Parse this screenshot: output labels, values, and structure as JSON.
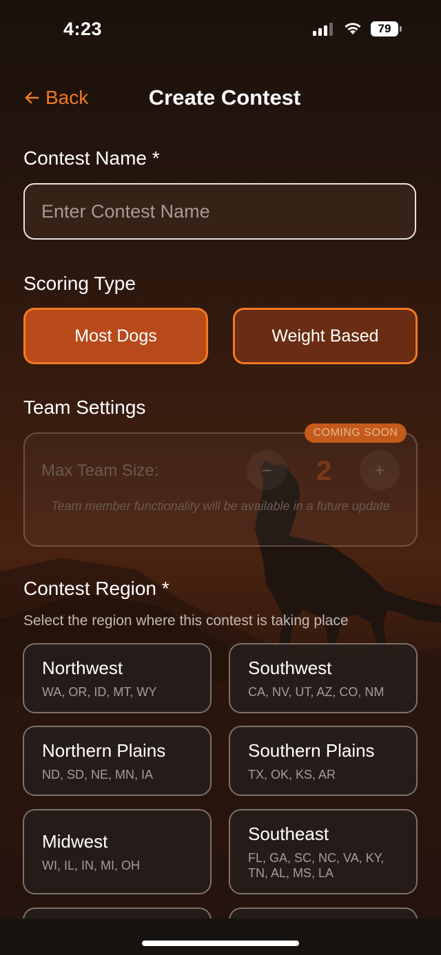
{
  "status_bar": {
    "time": "4:23",
    "battery": "79"
  },
  "header": {
    "back_label": "Back",
    "title": "Create Contest"
  },
  "contest_name": {
    "label": "Contest Name *",
    "placeholder": "Enter Contest Name",
    "value": ""
  },
  "scoring": {
    "label": "Scoring Type",
    "options": [
      "Most Dogs",
      "Weight Based"
    ],
    "selected": "Most Dogs"
  },
  "team": {
    "label": "Team Settings",
    "badge": "COMING SOON",
    "max_label": "Max Team Size:",
    "minus": "−",
    "value": "2",
    "plus": "+",
    "note": "Team member functionality will be available in a future update"
  },
  "region": {
    "label": "Contest Region *",
    "subtitle": "Select the region where this contest is taking place",
    "items": [
      {
        "name": "Northwest",
        "states": "WA, OR, ID, MT, WY"
      },
      {
        "name": "Southwest",
        "states": "CA, NV, UT, AZ, CO, NM"
      },
      {
        "name": "Northern Plains",
        "states": "ND, SD, NE, MN, IA"
      },
      {
        "name": "Southern Plains",
        "states": "TX, OK, KS, AR"
      },
      {
        "name": "Midwest",
        "states": "WI, IL, IN, MI, OH"
      },
      {
        "name": "Southeast",
        "states": "FL, GA, SC, NC, VA, KY, TN, AL, MS, LA"
      }
    ]
  },
  "colors": {
    "accent": "#f27a22",
    "selected_bg": "#b84a1b",
    "unselected_bg": "#6a2c12"
  }
}
